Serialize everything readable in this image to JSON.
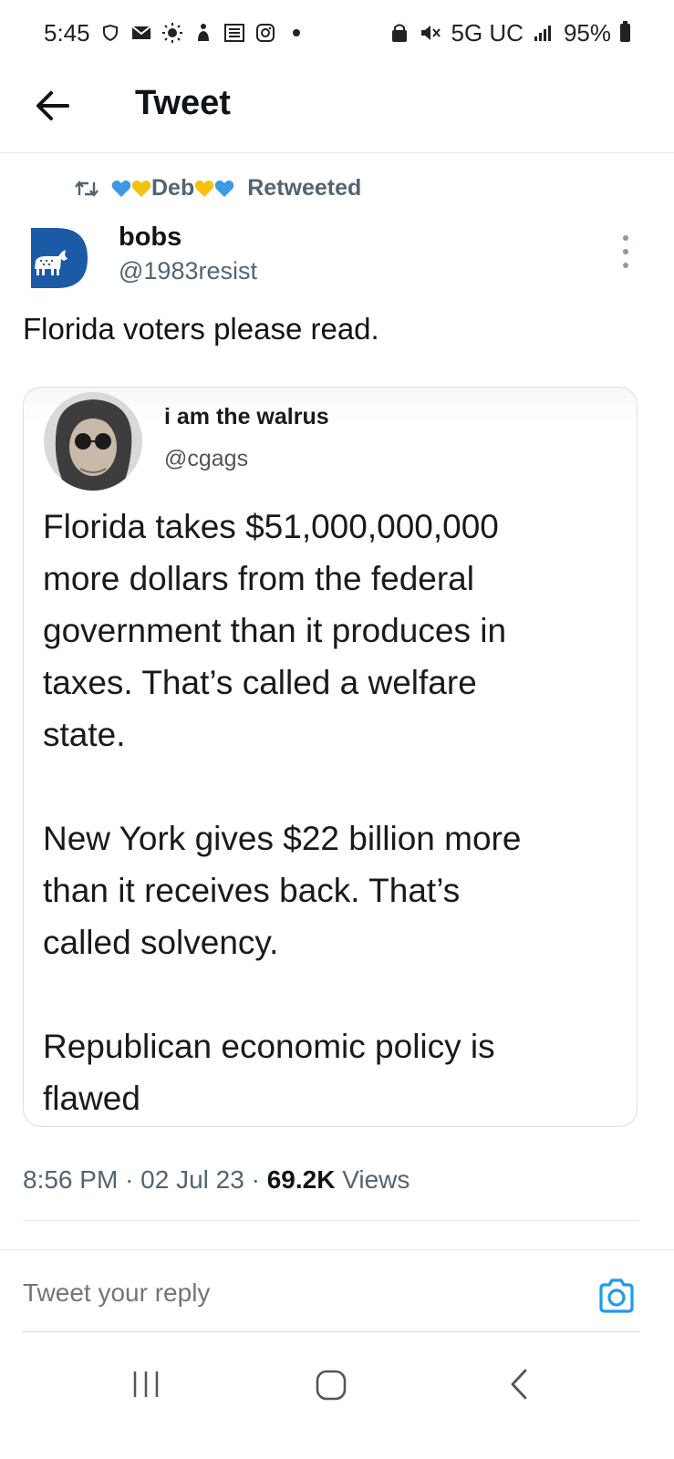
{
  "status_bar": {
    "time": "5:45",
    "network": "5G UC",
    "battery": "95%",
    "left_icons": [
      "shield-icon",
      "mail-icon",
      "weather-icon",
      "figure-icon",
      "news-icon",
      "instagram-icon",
      "dot-icon"
    ],
    "right_icons": [
      "recycle-lock-icon",
      "mute-icon",
      "signal-icon",
      "battery-icon"
    ]
  },
  "header": {
    "title": "Tweet",
    "back_icon": "back-arrow-icon"
  },
  "retweet": {
    "name": "Deb",
    "suffix": "Retweeted",
    "icon": "retweet-icon",
    "heart_colors": [
      "#3b99e6",
      "#f4c20d"
    ]
  },
  "tweet": {
    "author_name": "bobs",
    "author_handle": "@1983resist",
    "text": "Florida voters please read.",
    "timestamp": "8:56 PM",
    "date": "02 Jul 23",
    "views_count": "69.2K",
    "views_label": "Views",
    "separator": "·"
  },
  "embedded_image": {
    "name": "i am the walrus",
    "handle": "@cgags",
    "paragraphs": [
      "Florida takes $51,000,000,000\nmore dollars from the federal\ngovernment than it produces in\ntaxes.  That’s called a welfare\nstate.",
      "New York gives $22 billion more\nthan it receives back.  That’s\ncalled solvency.",
      "Republican economic policy is\nflawed"
    ]
  },
  "reply": {
    "placeholder": "Tweet your reply",
    "camera_icon": "camera-icon"
  },
  "nav_bar": {
    "items": [
      "recents-icon",
      "home-icon",
      "back-icon"
    ]
  },
  "colors": {
    "accent": "#1d9bf0",
    "text_primary": "#0f1419",
    "text_secondary": "#536471",
    "democrat_blue": "#1a5aa6"
  }
}
